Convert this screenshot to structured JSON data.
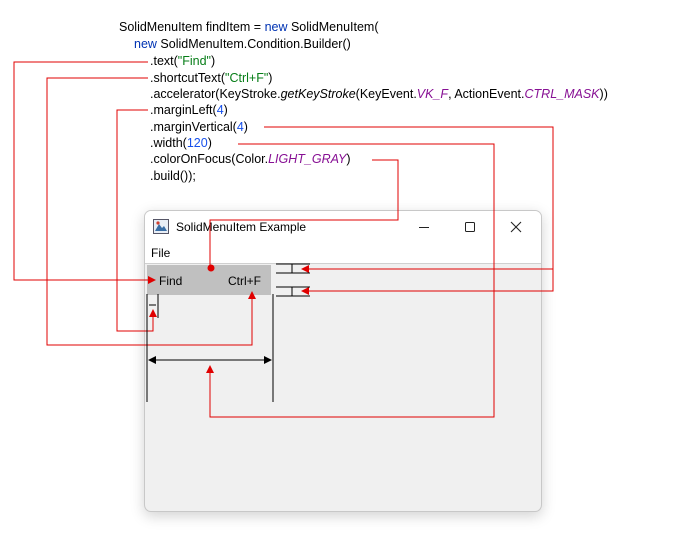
{
  "code": {
    "line1": {
      "a": "SolidMenuItem findItem = ",
      "kw": "new",
      "b": " SolidMenuItem("
    },
    "line2": {
      "kw": "new",
      "b": " SolidMenuItem.Condition.Builder()"
    },
    "line3": {
      "a": ".text(",
      "str": "\"Find\"",
      "b": ")"
    },
    "line4": {
      "a": ".shortcutText(",
      "str": "\"Ctrl+F\"",
      "b": ")"
    },
    "line5": {
      "a": ".accelerator(KeyStroke.",
      "it": "getKeyStroke",
      "b": "(KeyEvent.",
      "c1": "VK_F",
      "c": ", ActionEvent.",
      "c2": "CTRL_MASK",
      "d": "))"
    },
    "line6": {
      "a": ".marginLeft(",
      "num": "4",
      "b": ")"
    },
    "line7": {
      "a": ".marginVertical(",
      "num": "4",
      "b": ")"
    },
    "line8": {
      "a": ".width(",
      "num": "120",
      "b": ")"
    },
    "line9": {
      "a": ".colorOnFocus(Color.",
      "c1": "LIGHT_GRAY",
      "b": ")"
    },
    "line10": {
      "a": ".build());"
    }
  },
  "window": {
    "title": "SolidMenuItem Example",
    "menu_file": "File",
    "item_text": "Find",
    "item_shortcut": "Ctrl+F",
    "focus_color": "#c0c0c0"
  },
  "colors": {
    "arrow": "#e00000",
    "keyword": "#0033b3",
    "string": "#067d17",
    "number": "#1750eb",
    "constant": "#871094"
  },
  "icons": [
    "app-icon",
    "minimize-icon",
    "maximize-icon",
    "close-icon"
  ]
}
